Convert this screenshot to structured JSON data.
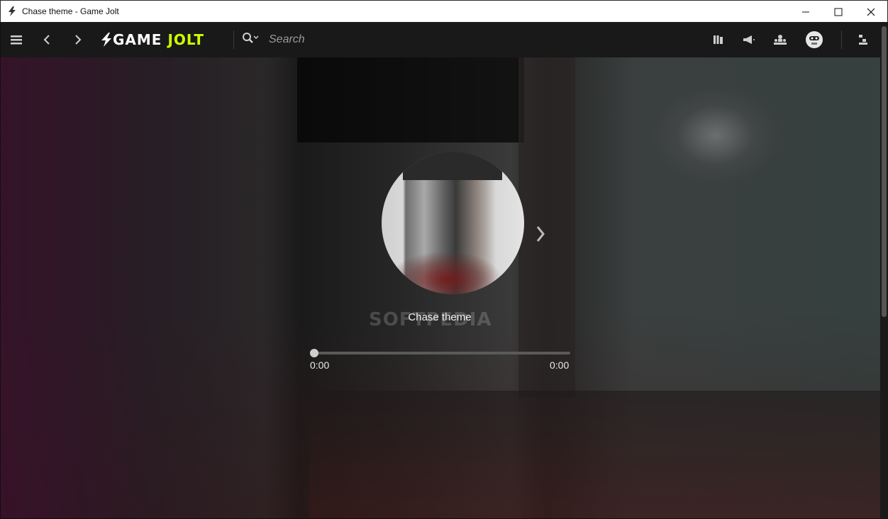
{
  "window": {
    "title": "Chase theme - Game Jolt",
    "controls": [
      "minimize",
      "maximize",
      "close"
    ]
  },
  "navbar": {
    "logo": {
      "game": "GAME",
      "jolt": "JOLT"
    },
    "search": {
      "placeholder": "Search",
      "value": ""
    },
    "icons": [
      "menu-icon",
      "back-icon",
      "forward-icon",
      "search-icon",
      "library-icon",
      "announcements-icon",
      "friends-icon",
      "avatar",
      "downloads-icon"
    ]
  },
  "player": {
    "track_title": "Chase theme",
    "time_elapsed": "0:00",
    "time_total": "0:00",
    "progress": 0,
    "watermark": "SOFTPEDIA"
  },
  "colors": {
    "accent": "#ccff00",
    "navbar_bg": "#191919"
  }
}
